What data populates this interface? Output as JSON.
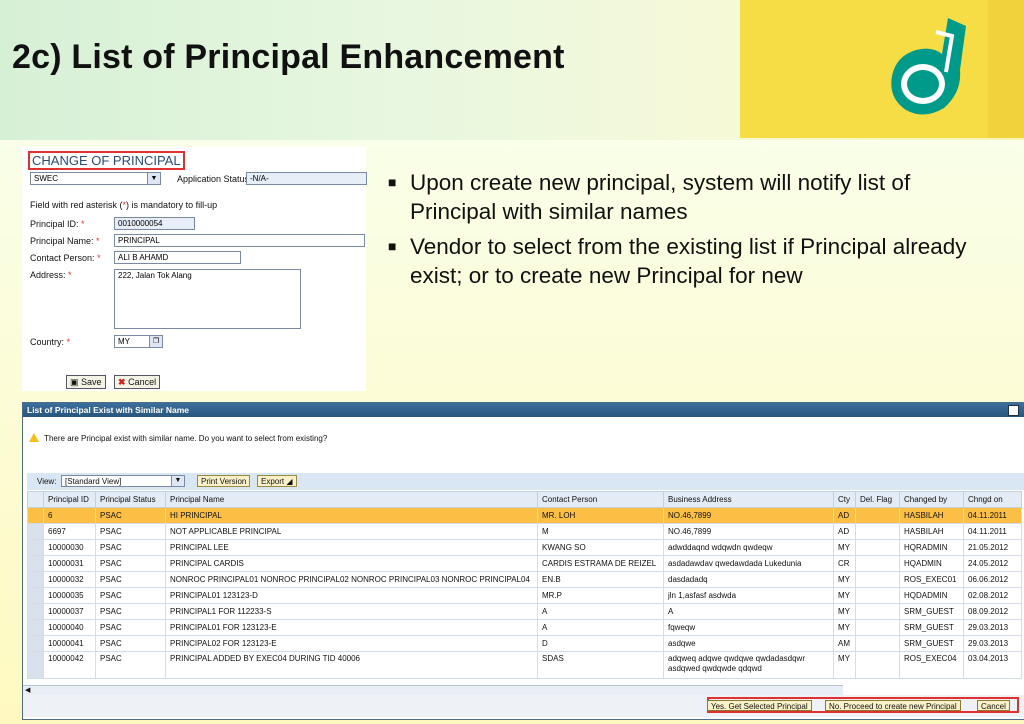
{
  "slide": {
    "title": "2c) List of Principal Enhancement",
    "bullets": [
      "Upon create new principal, system will notify list of Principal with similar names",
      "Vendor to select from the existing list if Principal already exist; or to create new Principal for new"
    ]
  },
  "form": {
    "title": "CHANGE OF PRINCIPAL",
    "type_value": "SWEC",
    "app_status_label": "Application Status:",
    "app_status_value": "-N/A-",
    "note_prefix": "Field with red asterisk (",
    "note_star": "*",
    "note_suffix": ") is mandatory to fill-up",
    "star": "*",
    "principal_id_label": "Principal ID:",
    "principal_id_value": "0010000054",
    "principal_name_label": "Principal Name:",
    "principal_name_value": "PRINCIPAL",
    "contact_label": "Contact Person:",
    "contact_value": "ALI B AHAMD",
    "address_label": "Address:",
    "address_value": "222, Jalan Tok Alang",
    "country_label": "Country:",
    "country_value": "MY",
    "save_label": "Save",
    "cancel_label": "Cancel"
  },
  "dialog": {
    "title": "List of Principal Exist with Similar Name",
    "message": "There are Principal exist with similar name. Do you want to select from existing?",
    "view_label": "View:",
    "view_value": "[Standard View]",
    "print_label": "Print Version",
    "export_label": "Export",
    "columns": [
      "Principal ID",
      "Principal Status",
      "Principal Name",
      "Contact Person",
      "Business Address",
      "Cty",
      "Del. Flag",
      "Changed by",
      "Chngd on"
    ],
    "rows": [
      [
        "6",
        "PSAC",
        "HI PRINCIPAL",
        "MR. LOH",
        "NO.46,7899",
        "AD",
        "",
        "HASBILAH",
        "04.11.2011"
      ],
      [
        "6697",
        "PSAC",
        "NOT APPLICABLE PRINCIPAL",
        "M",
        "NO.46,7899",
        "AD",
        "",
        "HASBILAH",
        "04.11.2011"
      ],
      [
        "10000030",
        "PSAC",
        "PRINCIPAL LEE",
        "KWANG SO",
        "adwddaqnd wdqwdn qwdeqw",
        "MY",
        "",
        "HQRADMIN",
        "21.05.2012"
      ],
      [
        "10000031",
        "PSAC",
        "PRINCIPAL CARDIS",
        "CARDIS ESTRAMA DE REIZEL",
        "asdadawdav qwedawdada Lukedunia",
        "CR",
        "",
        "HQADMIN",
        "24.05.2012"
      ],
      [
        "10000032",
        "PSAC",
        "NONROC PRINCIPAL01 NONROC PRINCIPAL02 NONROC PRINCIPAL03 NONROC PRINCIPAL04",
        "EN.B",
        "dasdadadq",
        "MY",
        "",
        "ROS_EXEC01",
        "06.06.2012"
      ],
      [
        "10000035",
        "PSAC",
        "PRINCIPAL01 123123-D",
        "MR.P",
        "jln 1,asfasf asdwda",
        "MY",
        "",
        "HQDADMIN",
        "02.08.2012"
      ],
      [
        "10000037",
        "PSAC",
        "PRINCIPAL1 FOR 112233-S",
        "A",
        "A",
        "MY",
        "",
        "SRM_GUEST",
        "08.09.2012"
      ],
      [
        "10000040",
        "PSAC",
        "PRINCIPAL01 FOR 123123-E",
        "A",
        "fqweqw",
        "MY",
        "",
        "SRM_GUEST",
        "29.03.2013"
      ],
      [
        "10000041",
        "PSAC",
        "PRINCIPAL02 FOR 123123-E",
        "D",
        "asdqwe",
        "AM",
        "",
        "SRM_GUEST",
        "29.03.2013"
      ],
      [
        "10000042",
        "PSAC",
        "PRINCIPAL ADDED BY EXEC04 DURING TID 40006",
        "SDAS",
        "adqweq adqwe qwdqwe qwdadasdqwr asdqwed qwdqwde qdqwd",
        "MY",
        "",
        "ROS_EXEC04",
        "03.04.2013"
      ]
    ],
    "btn_yes": "Yes. Get Selected Principal",
    "btn_no": "No. Proceed to create new Principal",
    "btn_cancel": "Cancel"
  },
  "colors": {
    "highlight_row": "#fbbf45",
    "outline": "#e03030",
    "dialog_header": "#2d5f8c"
  }
}
